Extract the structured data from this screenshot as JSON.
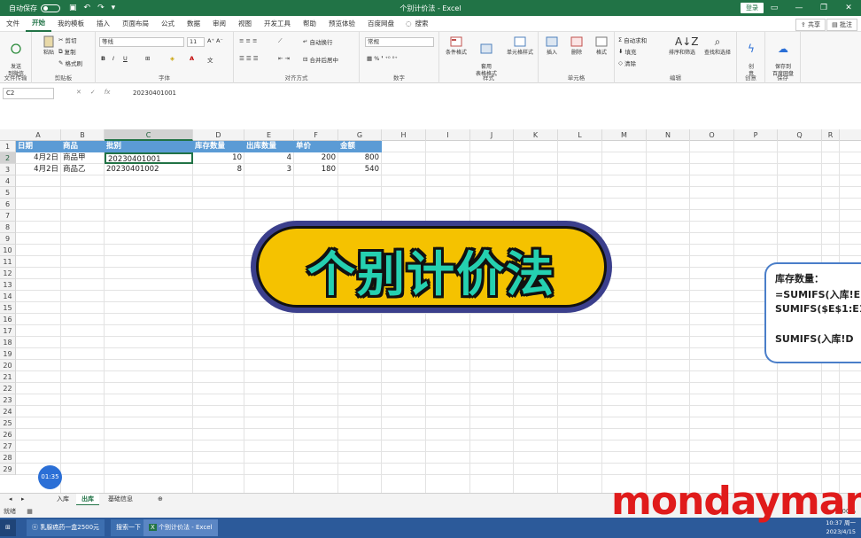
{
  "titlebar": {
    "autosave_label": "自动保存",
    "autosave_state": "关",
    "doc_title": "个别计价法 - Excel",
    "search_placeholder": "搜索",
    "login_label": "登录"
  },
  "menu": {
    "tabs": [
      "文件",
      "开始",
      "我的模板",
      "插入",
      "页面布局",
      "公式",
      "数据",
      "审阅",
      "视图",
      "开发工具",
      "帮助",
      "预览体验",
      "百度网盘"
    ],
    "active_tab": "开始",
    "search_label": "搜索",
    "share_label": "共享",
    "comment_label": "批注"
  },
  "ribbon": {
    "groups": {
      "baidu": "文件传输",
      "clipboard": "剪贴板",
      "font": "字体",
      "align": "对齐方式",
      "number": "数字",
      "style": "样式",
      "cells": "单元格",
      "edit": "编辑",
      "creative": "创意",
      "save": "保存"
    },
    "send_file": "发送\n到微信",
    "paste": "粘贴",
    "cut": "剪切",
    "copy": "复制",
    "format_painter": "格式刷",
    "font_name": "等线",
    "font_size": "11",
    "wrap_text": "自动换行",
    "merge_center": "合并后居中",
    "number_format": "常规",
    "cond_format": "条件格式",
    "table_format": "套用\n表格格式",
    "cell_style": "单元格样式",
    "insert": "插入",
    "delete": "删除",
    "format": "格式",
    "autosum": "自动求和",
    "fill": "填充",
    "clear": "清除",
    "sort_filter": "排序和筛选",
    "find_select": "查找和选择",
    "creative_btn": "创\n意",
    "save_baidu": "保存到\n百度网盘"
  },
  "formula_bar": {
    "name_box": "C2",
    "value": "20230401001"
  },
  "columns": [
    "A",
    "B",
    "C",
    "D",
    "E",
    "F",
    "G",
    "H",
    "I",
    "J",
    "K",
    "L",
    "M",
    "N",
    "O",
    "P",
    "Q",
    "R"
  ],
  "rows": [
    "1",
    "2",
    "3",
    "4",
    "5",
    "6",
    "7",
    "8",
    "9",
    "10",
    "11",
    "12",
    "13",
    "14",
    "15",
    "16",
    "17",
    "18",
    "19",
    "20",
    "21",
    "22",
    "23",
    "24",
    "25",
    "26",
    "27",
    "28",
    "29"
  ],
  "table": {
    "headers": [
      "日期",
      "商品",
      "批别",
      "库存数量",
      "出库数量",
      "单价",
      "金额"
    ],
    "data": [
      [
        "4月2日",
        "商品甲",
        "20230401001",
        "10",
        "4",
        "200",
        "800"
      ],
      [
        "4月2日",
        "商品乙",
        "20230401002",
        "8",
        "3",
        "180",
        "540"
      ]
    ]
  },
  "banner": {
    "text": "个别计价法",
    "colors": {
      "outer": "#3b3f8c",
      "fill": "#f5c200",
      "text": "#25d0b0"
    }
  },
  "card": {
    "line1": "库存数量：",
    "line2": "=SUMIFS(入库!E",
    "line3": "SUMIFS($E$1:E1",
    "line4": "SUMIFS(入库!D"
  },
  "timer": "01:35",
  "sheets": {
    "tabs": [
      "入库",
      "出库",
      "基础信息"
    ],
    "active": "出库"
  },
  "status": {
    "ready": "就绪",
    "zoom": "100%"
  },
  "taskbar": {
    "item1": "乳腺癌药一盒2500元",
    "item2": "搜索一下",
    "item3": "个别计价法 - Excel",
    "time": "10:37 周一",
    "date": "2023/4/15"
  },
  "watermark": "mondayman",
  "accent": "#217346"
}
